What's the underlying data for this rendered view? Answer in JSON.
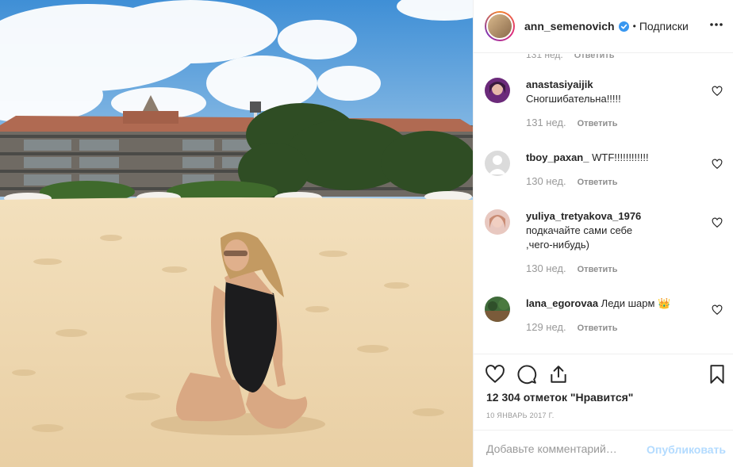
{
  "header": {
    "username": "ann_semenovich",
    "separator": "•",
    "follow_label": "Подписки"
  },
  "partial_comment": {
    "time": "131 нед.",
    "reply": "Ответить"
  },
  "comments": [
    {
      "username": "anastasiyaijik",
      "text": "Сногшибательна!!!!!",
      "time": "131 нед.",
      "reply": "Ответить"
    },
    {
      "username": "tboy_paxan_",
      "text": "WTF!!!!!!!!!!!!",
      "time": "130 нед.",
      "reply": "Ответить"
    },
    {
      "username": "yuliya_tretyakova_1976",
      "text": "подкачайте сами себе ,чего-нибудь)",
      "time": "130 нед.",
      "reply": "Ответить"
    },
    {
      "username": "lana_egorovaa",
      "text": "Леди шарм 👑",
      "time": "129 нед.",
      "reply": "Ответить"
    }
  ],
  "likes_text": "12 304 отметок \"Нравится\"",
  "date_text": "10 ЯНВАРЬ 2017 Г.",
  "comment_box": {
    "placeholder": "Добавьте комментарий…",
    "publish_label": "Опубликовать"
  },
  "colors": {
    "link_disabled": "#b3dbff",
    "verified": "#3897f0",
    "meta": "#999999"
  }
}
